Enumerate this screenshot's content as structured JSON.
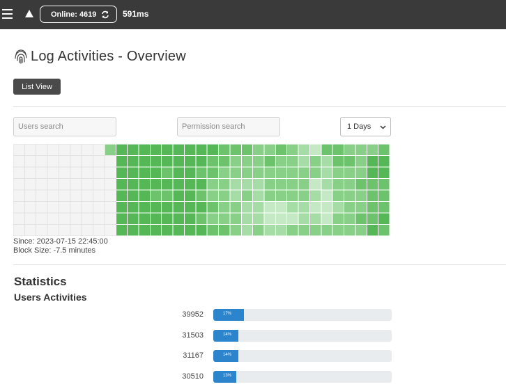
{
  "topbar": {
    "online_label": "Online: 4619",
    "latency": "591ms",
    "icons": {
      "menu": "hamburger-icon",
      "warning": "warning-icon",
      "refresh": "refresh-icon"
    },
    "bg_color": "#3a3a3a"
  },
  "page": {
    "title": "Log Activities - Overview",
    "title_icon": "fingerprint-icon",
    "list_view_label": "List View"
  },
  "filters": {
    "users_placeholder": "Users search",
    "permission_placeholder": "Permission search",
    "range_selected": "1 Days"
  },
  "heatmap": {
    "since": "Since: 2023-07-15 22:45:00",
    "block_size": "Block Size: -7.5 minutes",
    "palette": [
      "#f4f4f4",
      "#c5e9c5",
      "#a6dca6",
      "#88d088",
      "#6cc36c",
      "#55b755"
    ],
    "columns": [
      [
        0,
        0,
        0,
        0,
        0,
        0,
        0,
        0
      ],
      [
        0,
        0,
        0,
        0,
        0,
        0,
        0,
        0
      ],
      [
        0,
        0,
        0,
        0,
        0,
        0,
        0,
        0
      ],
      [
        0,
        0,
        0,
        0,
        0,
        0,
        0,
        0
      ],
      [
        0,
        0,
        0,
        0,
        0,
        0,
        0,
        0
      ],
      [
        0,
        0,
        0,
        0,
        0,
        0,
        0,
        0
      ],
      [
        0,
        0,
        0,
        0,
        0,
        0,
        0,
        0
      ],
      [
        0,
        0,
        0,
        0,
        0,
        0,
        0,
        0
      ],
      [
        3,
        0,
        0,
        0,
        0,
        0,
        0,
        0
      ],
      [
        5,
        5,
        5,
        5,
        5,
        5,
        5,
        5
      ],
      [
        5,
        5,
        5,
        5,
        5,
        5,
        5,
        5
      ],
      [
        5,
        5,
        5,
        5,
        5,
        5,
        5,
        5
      ],
      [
        5,
        5,
        5,
        5,
        4,
        5,
        5,
        5
      ],
      [
        5,
        5,
        4,
        5,
        4,
        5,
        5,
        5
      ],
      [
        5,
        5,
        5,
        5,
        5,
        5,
        5,
        5
      ],
      [
        5,
        5,
        5,
        5,
        5,
        5,
        5,
        5
      ],
      [
        5,
        5,
        4,
        5,
        4,
        5,
        4,
        5
      ],
      [
        5,
        4,
        4,
        3,
        3,
        4,
        3,
        4
      ],
      [
        4,
        4,
        3,
        3,
        3,
        3,
        3,
        4
      ],
      [
        4,
        3,
        3,
        2,
        2,
        3,
        3,
        3
      ],
      [
        4,
        3,
        3,
        2,
        3,
        2,
        2,
        2
      ],
      [
        3,
        3,
        3,
        2,
        2,
        2,
        2,
        3
      ],
      [
        3,
        4,
        3,
        3,
        3,
        1,
        1,
        2
      ],
      [
        4,
        3,
        3,
        3,
        3,
        1,
        1,
        2
      ],
      [
        3,
        3,
        3,
        3,
        3,
        2,
        1,
        3
      ],
      [
        2,
        2,
        3,
        3,
        3,
        2,
        2,
        3
      ],
      [
        1,
        3,
        3,
        1,
        2,
        1,
        2,
        3
      ],
      [
        4,
        2,
        2,
        2,
        1,
        1,
        1,
        3
      ],
      [
        4,
        4,
        3,
        3,
        3,
        2,
        3,
        3
      ],
      [
        3,
        4,
        3,
        3,
        3,
        3,
        3,
        3
      ],
      [
        3,
        3,
        3,
        4,
        3,
        3,
        4,
        3
      ],
      [
        3,
        5,
        5,
        4,
        4,
        4,
        4,
        5
      ],
      [
        4,
        5,
        5,
        4,
        4,
        4,
        5,
        4
      ]
    ]
  },
  "statistics": {
    "title": "Statistics",
    "subtitle": "Users Activities",
    "rows": [
      {
        "value": "39952",
        "percent_label": "17%",
        "fraction": 0.17
      },
      {
        "value": "31503",
        "percent_label": "14%",
        "fraction": 0.14
      },
      {
        "value": "31167",
        "percent_label": "14%",
        "fraction": 0.14
      },
      {
        "value": "30510",
        "percent_label": "13%",
        "fraction": 0.13
      }
    ],
    "bar_color": "#2b84cc"
  }
}
